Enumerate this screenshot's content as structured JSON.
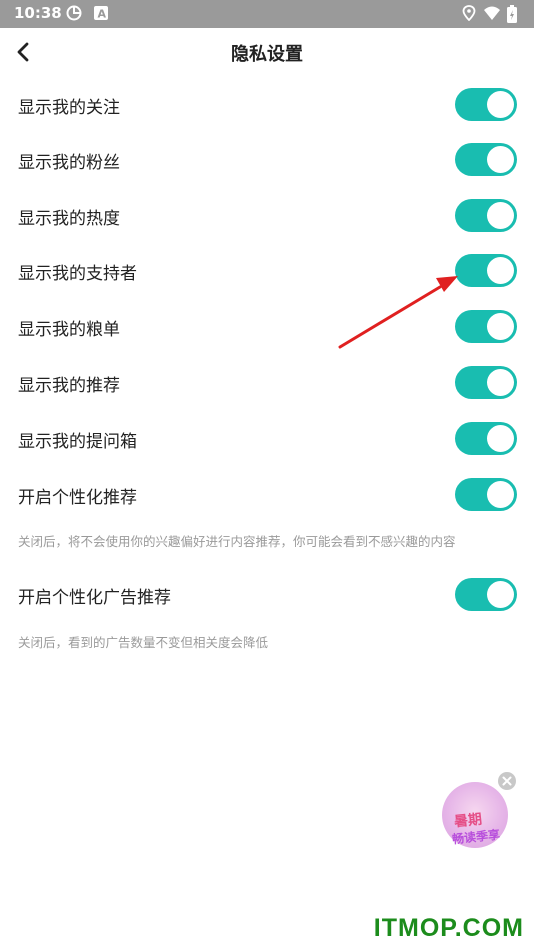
{
  "status_bar": {
    "time": "10:38",
    "icons": [
      "sync-icon",
      "font-app-icon",
      "location-icon",
      "wifi-icon",
      "battery-icon"
    ]
  },
  "header": {
    "title": "隐私设置",
    "back_icon": "chevron-left-icon"
  },
  "settings": [
    {
      "label": "显示我的关注",
      "enabled": true
    },
    {
      "label": "显示我的粉丝",
      "enabled": true
    },
    {
      "label": "显示我的热度",
      "enabled": true
    },
    {
      "label": "显示我的支持者",
      "enabled": true
    },
    {
      "label": "显示我的粮单",
      "enabled": true
    },
    {
      "label": "显示我的推荐",
      "enabled": true
    },
    {
      "label": "显示我的提问箱",
      "enabled": true
    },
    {
      "label": "开启个性化推荐",
      "enabled": true,
      "hint": "关闭后，将不会使用你的兴趣偏好进行内容推荐，你可能会看到不感兴趣的内容"
    },
    {
      "label": "开启个性化广告推荐",
      "enabled": true,
      "hint": "关闭后，看到的广告数量不变但相关度会降低"
    }
  ],
  "colors": {
    "toggle_on": "#19bdb0",
    "annotation_arrow": "#e02020",
    "status_bar_bg": "#9a9a9a"
  },
  "promo": {
    "line1": "暑期",
    "line2": "畅读季享"
  },
  "watermark": "ITMOP.COM"
}
